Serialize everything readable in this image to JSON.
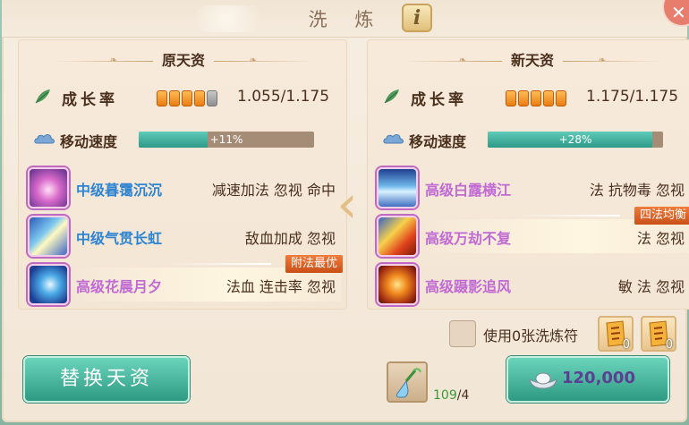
{
  "window": {
    "title": "洗 炼",
    "info_label": "i"
  },
  "left_panel": {
    "title": "原天资",
    "growth": {
      "label": "成长率",
      "pips_on": 4,
      "pips_total": 5,
      "value": "1.055/1.175"
    },
    "speed": {
      "label": "移动速度",
      "percent": 11,
      "text": "+11%"
    },
    "skills": [
      {
        "name": "中级暮霭沉沉",
        "attrs": "减速加法 忽视 命中",
        "grade": "mid",
        "tag": ""
      },
      {
        "name": "中级气贯长虹",
        "attrs": "敌血加成 忽视",
        "grade": "mid",
        "tag": ""
      },
      {
        "name": "高级花晨月夕",
        "attrs": "法血 连击率 忽视",
        "grade": "high",
        "tag": "附法最优"
      }
    ]
  },
  "right_panel": {
    "title": "新天资",
    "growth": {
      "label": "成长率",
      "pips_on": 5,
      "pips_total": 5,
      "value": "1.175/1.175"
    },
    "speed": {
      "label": "移动速度",
      "percent": 28,
      "text": "+28%"
    },
    "skills": [
      {
        "name": "高级白露横江",
        "attrs": "法 抗物毒 忽视",
        "grade": "high",
        "tag": ""
      },
      {
        "name": "高级万劫不复",
        "attrs": "法 忽视",
        "grade": "high",
        "tag": "四法均衡"
      },
      {
        "name": "高级蹑影追风",
        "attrs": "敏 法 忽视",
        "grade": "high",
        "tag": ""
      }
    ]
  },
  "talisman": {
    "label": "使用0张洗炼符",
    "items": [
      {
        "count": "0"
      },
      {
        "count": "0"
      }
    ]
  },
  "buttons": {
    "replace": "替换天资",
    "cost": "120,000"
  },
  "bottle": {
    "have": "109",
    "need": "/4"
  },
  "colors": {
    "accent_green": "#2f9a83",
    "pip_orange": "#ea7d13",
    "tag_orange": "#c94f17"
  }
}
